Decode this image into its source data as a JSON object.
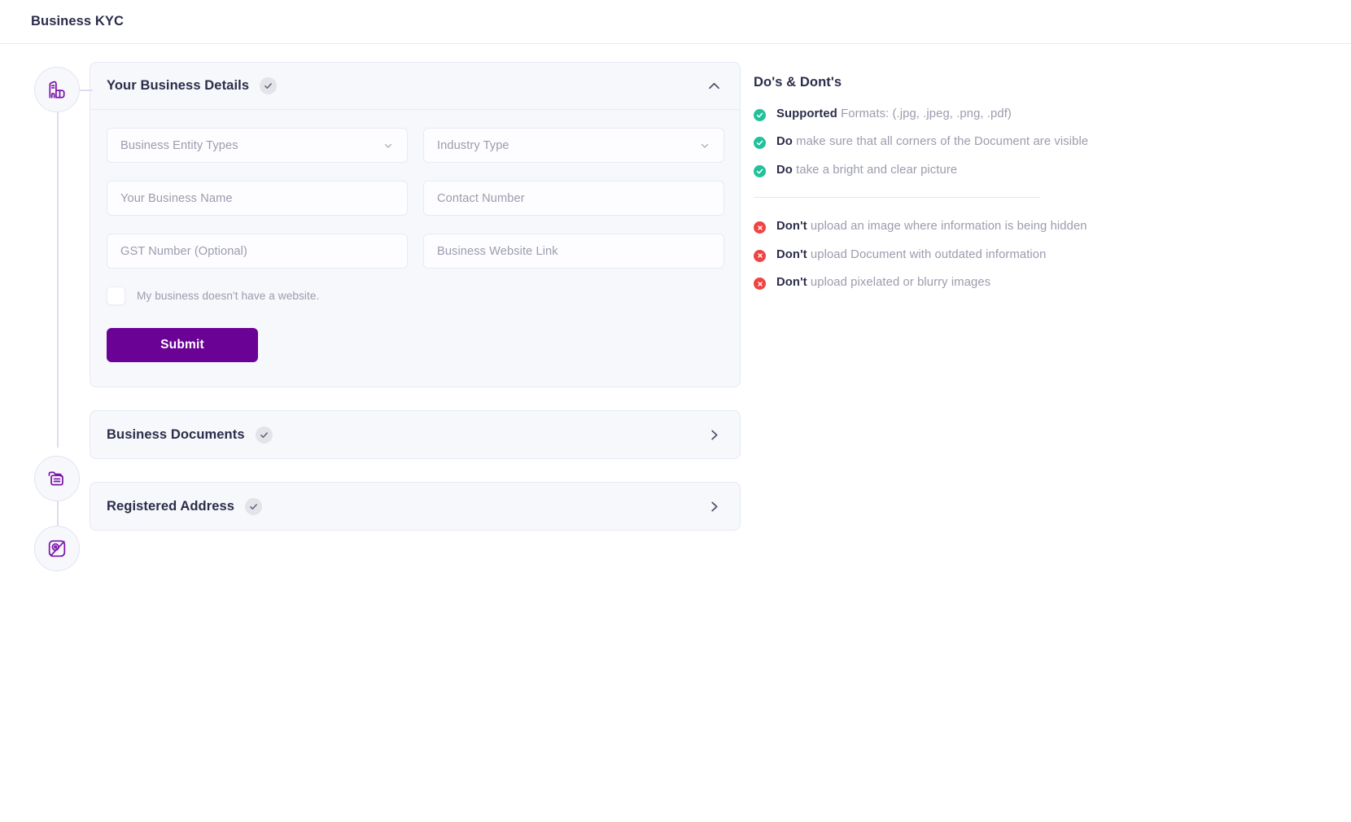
{
  "header": {
    "title": "Business KYC"
  },
  "stepper": {
    "nodes": [
      {
        "icon": "business-building-icon"
      },
      {
        "icon": "folder-document-icon"
      },
      {
        "icon": "map-location-icon"
      }
    ]
  },
  "sections": [
    {
      "id": "business-details",
      "title": "Your Business Details",
      "check_icon": "check-icon",
      "toggle_icon": "chevron-up-icon",
      "expanded": true
    },
    {
      "id": "business-documents",
      "title": "Business Documents",
      "check_icon": "check-icon",
      "toggle_icon": "chevron-right-icon",
      "expanded": false
    },
    {
      "id": "registered-address",
      "title": "Registered Address",
      "check_icon": "check-icon",
      "toggle_icon": "chevron-right-icon",
      "expanded": false
    }
  ],
  "form": {
    "fields": [
      {
        "name": "business-entity-types",
        "placeholder": "Business Entity Types",
        "value": "",
        "type": "select",
        "caret": "chevron-down-icon"
      },
      {
        "name": "industry-type",
        "placeholder": "Industry Type",
        "value": "",
        "type": "select",
        "caret": "chevron-down-icon"
      },
      {
        "name": "business-name",
        "placeholder": "Your Business Name",
        "value": "",
        "type": "text"
      },
      {
        "name": "contact-number",
        "placeholder": "Contact Number",
        "value": "",
        "type": "text"
      },
      {
        "name": "gst-number",
        "placeholder": "GST Number (Optional)",
        "value": "",
        "type": "text"
      },
      {
        "name": "business-website-link",
        "placeholder": "Business Website Link",
        "value": "",
        "type": "text"
      }
    ],
    "checkbox": {
      "label": "My business doesn't have a website.",
      "checked": false
    },
    "submit_label": "Submit"
  },
  "guidelines": {
    "title": "Do's & Dont's",
    "dos": [
      {
        "icon": "check-circle-icon",
        "lead": "Supported",
        "rest": " Formats: (.jpg, .jpeg, .png, .pdf)"
      },
      {
        "icon": "check-circle-icon",
        "lead": "Do",
        "rest": " make sure that all corners of the Document are visible"
      },
      {
        "icon": "check-circle-icon",
        "lead": "Do",
        "rest": " take a bright and clear picture"
      }
    ],
    "donts": [
      {
        "icon": "cross-circle-icon",
        "lead": "Don't",
        "rest": " upload an image where information is being hidden"
      },
      {
        "icon": "cross-circle-icon",
        "lead": "Don't",
        "rest": " upload Document with outdated information"
      },
      {
        "icon": "cross-circle-icon",
        "lead": "Don't",
        "rest": " upload pixelated or blurry images"
      }
    ]
  },
  "colors": {
    "brand_purple": "#6b0296",
    "icon_purple": "#7b14a8",
    "title_navy": "#2b2d4a",
    "muted_text": "#9a9cad",
    "success_green": "#21c19a",
    "error_red": "#ef4444",
    "card_bg": "#f7f8fc",
    "card_border": "#e6e9f5"
  }
}
